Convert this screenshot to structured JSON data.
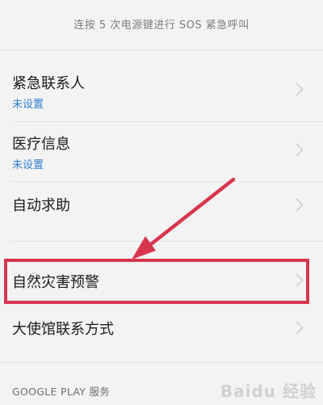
{
  "header": {
    "hint": "连按 5 次电源键进行 SOS 紧急呼叫"
  },
  "rows": [
    {
      "title": "紧急联系人",
      "subtitle": "未设置"
    },
    {
      "title": "医疗信息",
      "subtitle": "未设置"
    },
    {
      "title": "自动求助"
    },
    {
      "title": "自然灾害预警"
    },
    {
      "title": "大使馆联系方式"
    }
  ],
  "section": {
    "label": "GOOGLE PLAY 服务"
  },
  "annotation": {
    "color": "#d8354f",
    "highlighted_row": "自然灾害预警"
  },
  "icons": {
    "chevron": "chevron-right-icon"
  },
  "watermark": {
    "text": "Baidu 经验"
  }
}
